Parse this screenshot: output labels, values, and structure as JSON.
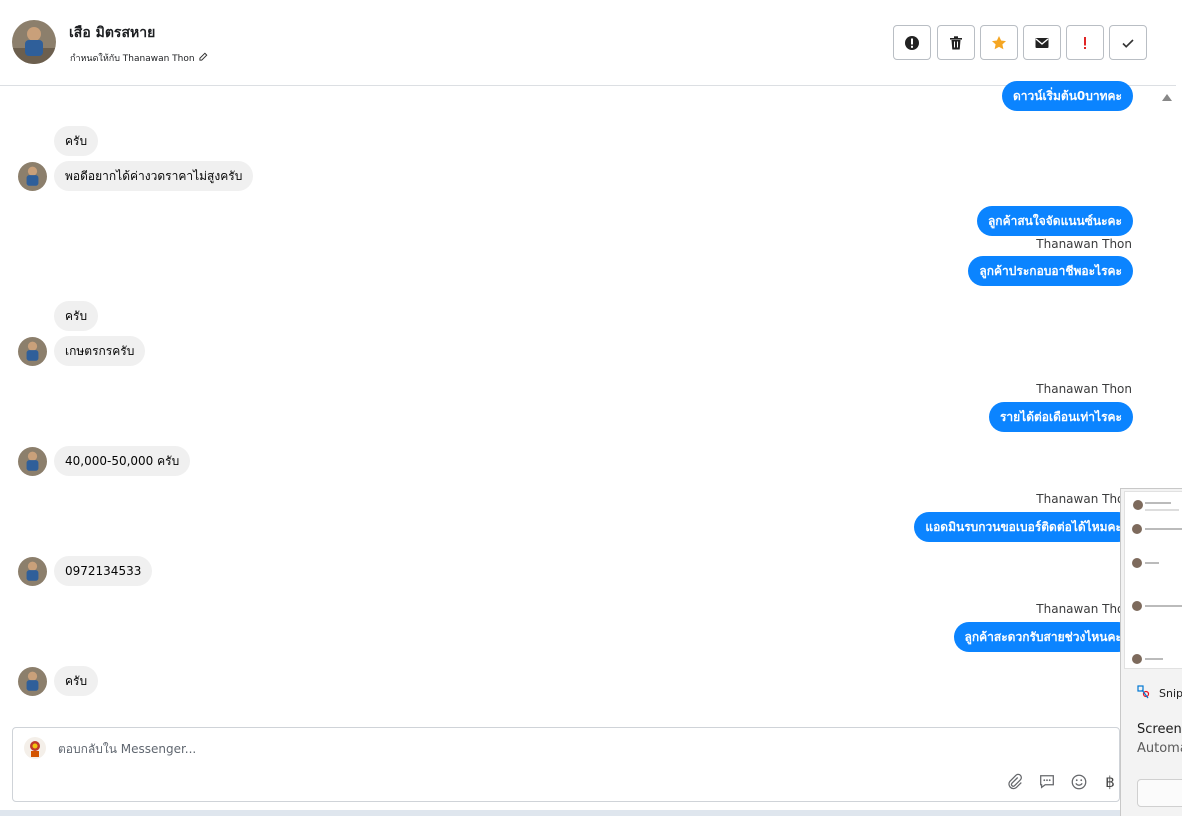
{
  "header": {
    "contact_name": "เสือ มิตรสหาย",
    "assigned_label": "กำหนดให้กับ Thanawan Thon"
  },
  "messages": {
    "m0": "ดาวน์เริ่มต้น0บาทคะ",
    "m1": "ครับ",
    "m2": "พอดีอยากได้ค่างวดราคาไม่สูงครับ",
    "m3": "ลูกค้าสนใจจัดแนนซ์นะคะ",
    "m3_sender": "Thanawan Thon",
    "m4": "ลูกค้าประกอบอาชีพอะไรคะ",
    "m5": "ครับ",
    "m6": "เกษตรกรครับ",
    "m7_sender": "Thanawan Thon",
    "m7": "รายได้ต่อเดือนเท่าไรคะ",
    "m8": "40,000-50,000 ครับ",
    "m9_sender": "Thanawan Thon",
    "m9": "แอดมินรบกวนขอเบอร์ติดต่อได้ไหมคะ",
    "m10": "0972134533",
    "m11_sender": "Thanawan Thon",
    "m11": "ลูกค้าสะดวกรับสายช่วงไหนคะ",
    "m12": "ครับ"
  },
  "composer": {
    "placeholder": "ตอบกลับใน Messenger...",
    "currency_symbol": "฿"
  },
  "snip": {
    "app_name": "Snip",
    "title": "Screens",
    "subtitle": "Automa"
  },
  "colors": {
    "outgoing_bubble": "#0b84ff",
    "incoming_bubble": "#f0f0f0",
    "star": "#f5a623",
    "alert_red": "#e02424"
  }
}
